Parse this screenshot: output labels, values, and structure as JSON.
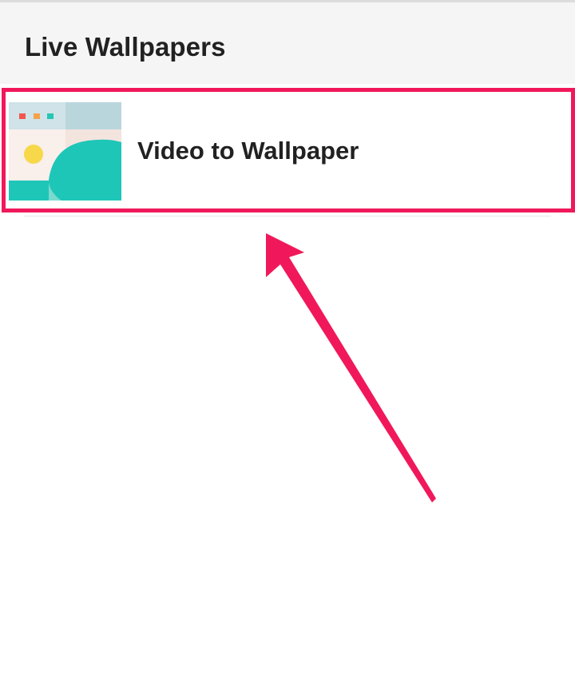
{
  "header": {
    "title": "Live Wallpapers"
  },
  "list": {
    "items": [
      {
        "label": "Video to Wallpaper",
        "icon": "video-wallpaper-thumbnail-icon"
      }
    ]
  },
  "annotation": {
    "highlight_color": "#f0185a",
    "arrow_color": "#f0185a",
    "arrow_icon": "pointer-arrow-icon"
  },
  "colors": {
    "header_bg": "#f5f5f5",
    "text": "#212121",
    "thumb_teal": "#1ec6b8",
    "thumb_yellow": "#f7d84a",
    "thumb_sky": "#b9d6dd",
    "thumb_cream": "#f8ece7"
  }
}
